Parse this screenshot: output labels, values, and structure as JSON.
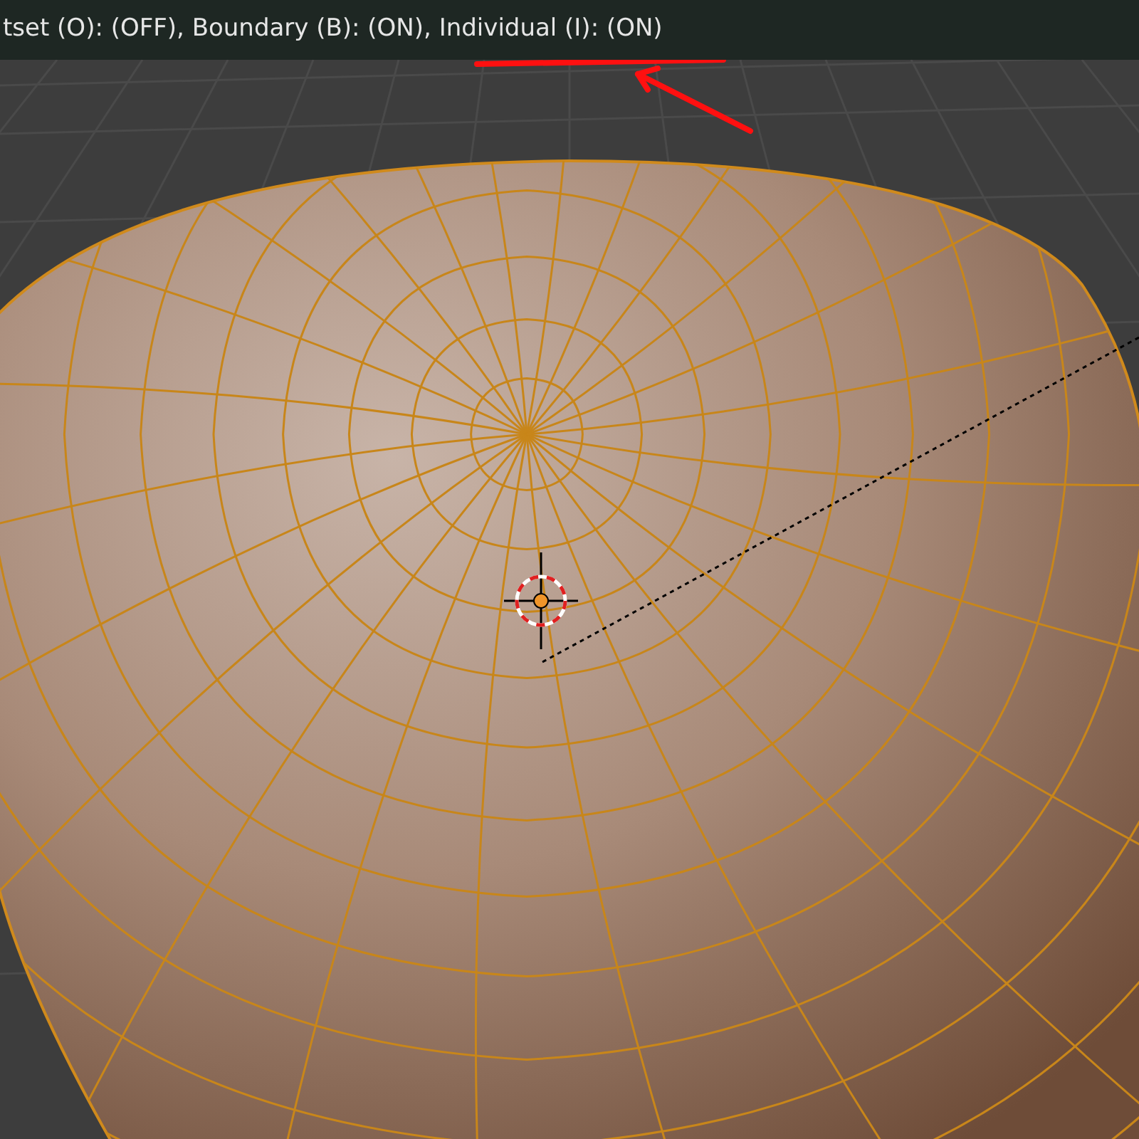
{
  "header": {
    "text": "tset (O): (OFF), Boundary (B): (ON), Individual (I): (ON)"
  }
}
